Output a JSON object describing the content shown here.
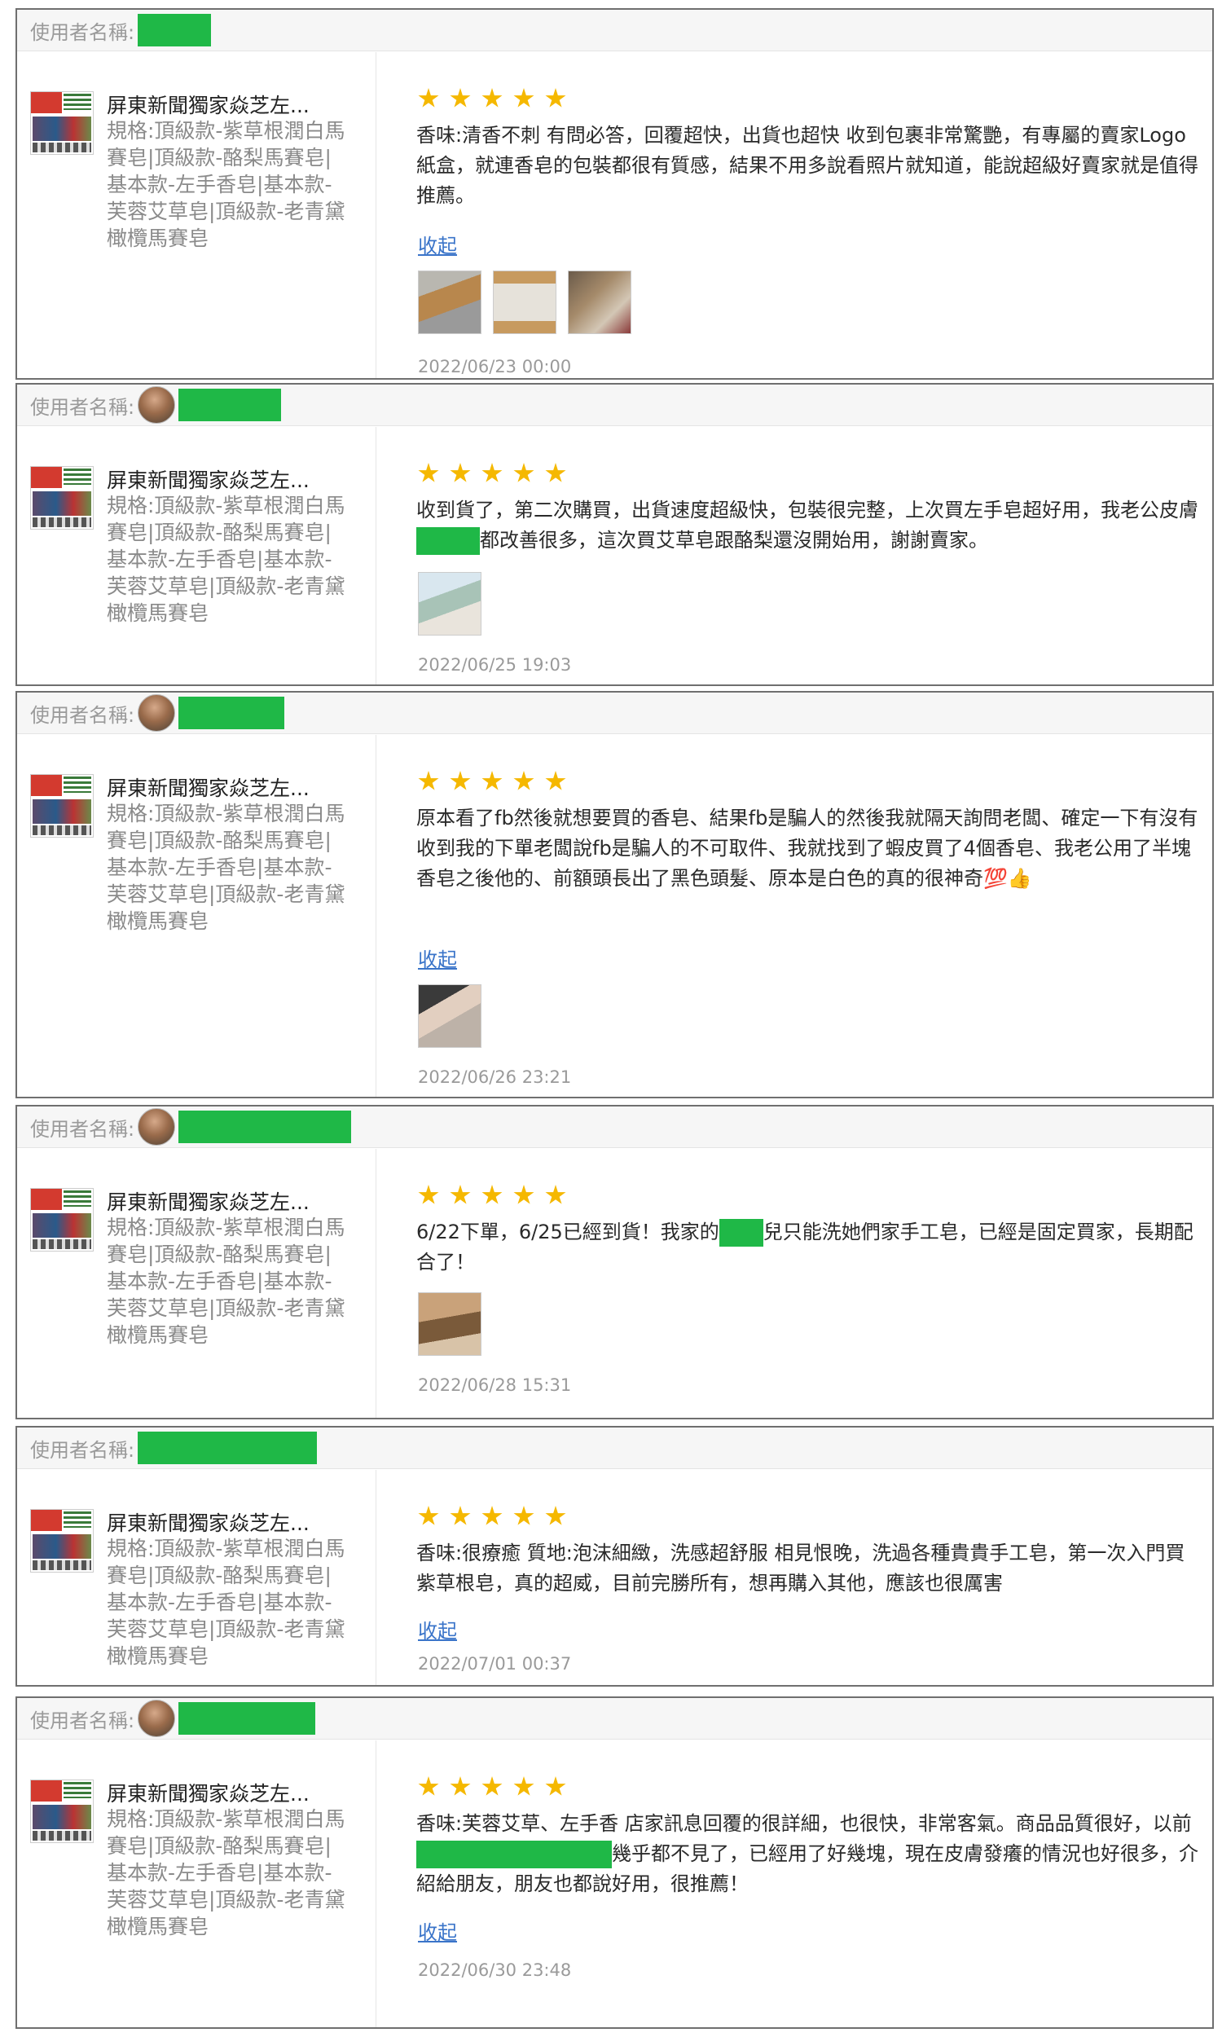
{
  "labels": {
    "username": "使用者名稱:",
    "collapse": "收起"
  },
  "product": {
    "name": "屏東新聞獨家焱芝左...",
    "spec": "規格:頂級款-紫草根潤白馬賽皂|頂級款-酪梨馬賽皂|基本款-左手香皂|基本款-芙蓉艾草皂|頂級款-老青黛橄欖馬賽皂"
  },
  "reviews": [
    {
      "rating": 5,
      "text": "香味:清香不刺 有問必答，回覆超快，出貨也超快 收到包裹非常驚艷，有專屬的賣家Logo紙盒，就連香皂的包裝都很有質感，結果不用多說看照片就知道，能說超級好賣家就是值得推薦。",
      "photos": [
        "photo-box-1",
        "photo-box-2",
        "photo-box-3"
      ],
      "date": "2022/06/23 00:00"
    },
    {
      "rating": 5,
      "text_a": "收到貨了，第二次購買，出貨速度超級快，包裝很完整，上次買左手皂超好用，我老公皮膚",
      "text_b": "都改善很多，這次買艾草皂跟酪梨還沒開始用，謝謝賣家。",
      "photos": [
        "photo-package"
      ],
      "date": "2022/06/25 19:03"
    },
    {
      "rating": 5,
      "text": "原本看了fb然後就想要買的香皂、結果fb是騙人的然後我就隔天詢問老闆、確定一下有沒有收到我的下單老闆說fb是騙人的不可取件、我就找到了蝦皮買了4個香皂、我老公用了半塊香皂之後他的、前額頭長出了黑色頭髮、原本是白色的真的很神奇💯👍",
      "photos": [
        "photo-head"
      ],
      "date": "2022/06/26 23:21"
    },
    {
      "rating": 5,
      "text_a": "6/22下單，6/25已經到貨！我家的",
      "text_b": "兒只能洗她們家手工皂，已經是固定買家，長期配合了！",
      "photos": [
        "photo-soap-box"
      ],
      "date": "2022/06/28 15:31"
    },
    {
      "rating": 5,
      "text": "香味:很療癒 質地:泡沫細緻，洗感超舒服 相見恨晚，洗過各種貴貴手工皂，第一次入門買紫草根皂，真的超威，目前完勝所有，想再購入其他，應該也很厲害",
      "date": "2022/07/01 00:37"
    },
    {
      "rating": 5,
      "text_a": "香味:芙蓉艾草、左手香 店家訊息回覆的很詳細，也很快，非常客氣。商品品質很好，以前",
      "text_b": "幾乎都不見了，已經用了好幾塊，現在皮膚發癢的情況也好很多，介紹給朋友，朋友也都說好用，很推薦！",
      "date": "2022/06/30 23:48"
    }
  ],
  "colors": {
    "star": "#f5b800",
    "link": "#3a74c9",
    "redaction": "#1fb847"
  }
}
